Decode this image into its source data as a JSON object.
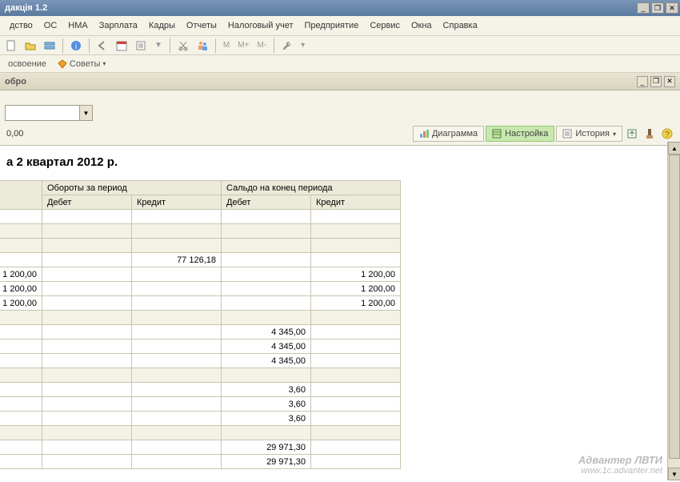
{
  "window": {
    "title": "дакція 1.2"
  },
  "menu": [
    "дство",
    "ОС",
    "НМА",
    "Зарплата",
    "Кадры",
    "Отчеты",
    "Налоговый учет",
    "Предприятие",
    "Сервис",
    "Окна",
    "Справка"
  ],
  "toolbar": {
    "m": "M",
    "mplus": "M+",
    "mminus": "M-"
  },
  "toolbar2": {
    "osvoenie": "освоение",
    "sovety": "Советы"
  },
  "doc": {
    "title": "обро"
  },
  "action": {
    "left_value": "0,00",
    "diagram": "Диаграмма",
    "settings": "Настройка",
    "history": "История"
  },
  "report": {
    "title": "а 2 квартал 2012 р.",
    "headers": {
      "group1": "Обороты за период",
      "group2": "Сальдо на конец периода",
      "debit": "Дебет",
      "credit": "Кредит"
    },
    "rows": [
      {
        "c0": "",
        "c1": "",
        "c2": "",
        "c3": "",
        "c4": "",
        "stripe": false
      },
      {
        "c0": "",
        "c1": "",
        "c2": "",
        "c3": "",
        "c4": "",
        "stripe": true
      },
      {
        "c0": "",
        "c1": "",
        "c2": "",
        "c3": "",
        "c4": "",
        "stripe": true
      },
      {
        "c0": "",
        "c1": "",
        "c2": "77 126,18",
        "c3": "",
        "c4": "",
        "stripe": false
      },
      {
        "c0": "1 200,00",
        "c1": "",
        "c2": "",
        "c3": "",
        "c4": "1 200,00",
        "stripe": false
      },
      {
        "c0": "1 200,00",
        "c1": "",
        "c2": "",
        "c3": "",
        "c4": "1 200,00",
        "stripe": false
      },
      {
        "c0": "1 200,00",
        "c1": "",
        "c2": "",
        "c3": "",
        "c4": "1 200,00",
        "stripe": false
      },
      {
        "c0": "",
        "c1": "",
        "c2": "",
        "c3": "",
        "c4": "",
        "stripe": true
      },
      {
        "c0": "",
        "c1": "",
        "c2": "",
        "c3": "4 345,00",
        "c4": "",
        "stripe": false
      },
      {
        "c0": "",
        "c1": "",
        "c2": "",
        "c3": "4 345,00",
        "c4": "",
        "stripe": false
      },
      {
        "c0": "",
        "c1": "",
        "c2": "",
        "c3": "4 345,00",
        "c4": "",
        "stripe": false
      },
      {
        "c0": "",
        "c1": "",
        "c2": "",
        "c3": "",
        "c4": "",
        "stripe": true
      },
      {
        "c0": "",
        "c1": "",
        "c2": "",
        "c3": "3,60",
        "c4": "",
        "stripe": false
      },
      {
        "c0": "",
        "c1": "",
        "c2": "",
        "c3": "3,60",
        "c4": "",
        "stripe": false
      },
      {
        "c0": "",
        "c1": "",
        "c2": "",
        "c3": "3,60",
        "c4": "",
        "stripe": false
      },
      {
        "c0": "",
        "c1": "",
        "c2": "",
        "c3": "",
        "c4": "",
        "stripe": true
      },
      {
        "c0": "",
        "c1": "",
        "c2": "",
        "c3": "29 971,30",
        "c4": "",
        "stripe": false
      },
      {
        "c0": "",
        "c1": "",
        "c2": "",
        "c3": "29 971,30",
        "c4": "",
        "stripe": false
      }
    ]
  },
  "watermark": {
    "line1": "Адвантер ЛВТИ",
    "line2": "www.1c.advanter.net"
  }
}
